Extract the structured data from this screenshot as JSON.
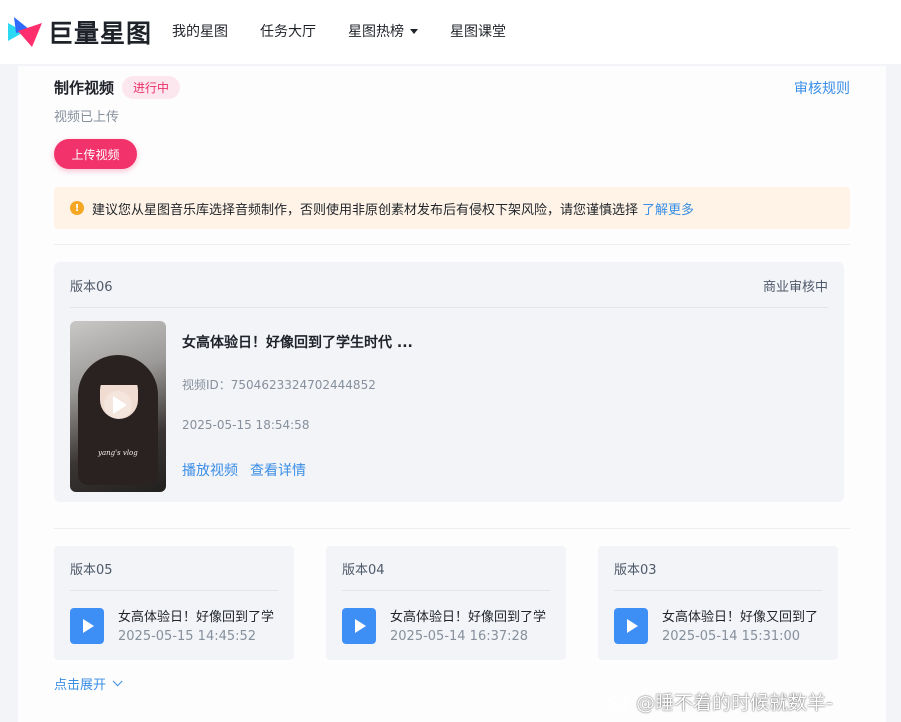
{
  "brand": {
    "name": "巨量星图"
  },
  "nav": [
    {
      "label": "我的星图"
    },
    {
      "label": "任务大厅"
    },
    {
      "label": "星图热榜",
      "has_dropdown": true
    },
    {
      "label": "星图课堂"
    }
  ],
  "task": {
    "title": "制作视频",
    "status_badge": "进行中",
    "rules_link": "审核规则",
    "subtitle": "视频已上传",
    "upload_button": "上传视频"
  },
  "notice": {
    "text": "建议您从星图音乐库选择音频制作，否则使用非原创素材发布后有侵权下架风险，请您谨慎选择",
    "link": "了解更多"
  },
  "current_version": {
    "label": "版本06",
    "status": "商业审核中",
    "video_title": "女高体验日！好像回到了学生时代 ...",
    "video_id": "视频ID：7504623324702444852",
    "date": "2025-05-15 18:54:58",
    "play_action": "播放视频",
    "detail_action": "查看详情",
    "thumbnail_caption": "yang's vlog"
  },
  "previous_versions": [
    {
      "label": "版本05",
      "title": "女高体验日！好像回到了学",
      "date": "2025-05-15 14:45:52"
    },
    {
      "label": "版本04",
      "title": "女高体验日！好像回到了学",
      "date": "2025-05-14 16:37:28"
    },
    {
      "label": "版本03",
      "title": "女高体验日！好像又回到了",
      "date": "2025-05-14 15:31:00"
    }
  ],
  "expand_link": "点击展开",
  "watermark": "@睡不着的时候就数羊-",
  "colors": {
    "accent_pink": "#f2336b",
    "link_blue": "#3a8ee6",
    "warning_orange": "#f5a623",
    "notice_bg": "#fef3e6"
  }
}
